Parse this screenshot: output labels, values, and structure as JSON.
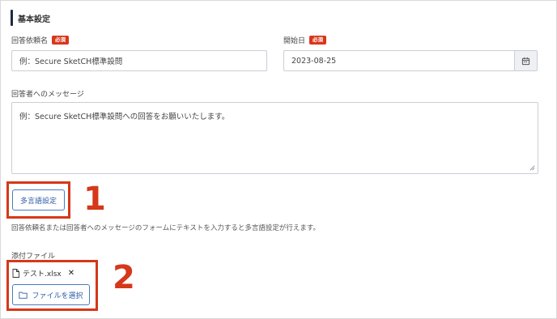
{
  "section": {
    "title": "基本設定"
  },
  "form": {
    "request_name": {
      "label": "回答依頼名",
      "required_badge": "必須",
      "value": "例：Secure SketCH標準設問"
    },
    "start_date": {
      "label": "開始日",
      "required_badge": "必須",
      "value": "2023-08-25",
      "icon": "calendar-icon"
    },
    "message": {
      "label": "回答者へのメッセージ",
      "value": "例：Secure SketCH標準設問への回答をお願いいたします。"
    },
    "multilang_button": "多言語設定",
    "help_text": "回答依頼名または回答者へのメッセージのフォームにテキストを入力すると多言語設定が行えます。",
    "attachment": {
      "label": "添付ファイル",
      "file_name": "テスト.xlsx",
      "select_button": "ファイルを選択"
    }
  },
  "callouts": {
    "one": "1",
    "two": "2"
  },
  "colors": {
    "accent": "#2f5ea8",
    "required": "#d9361c",
    "callout": "#d5381a",
    "section_bar": "#1f2a44"
  }
}
